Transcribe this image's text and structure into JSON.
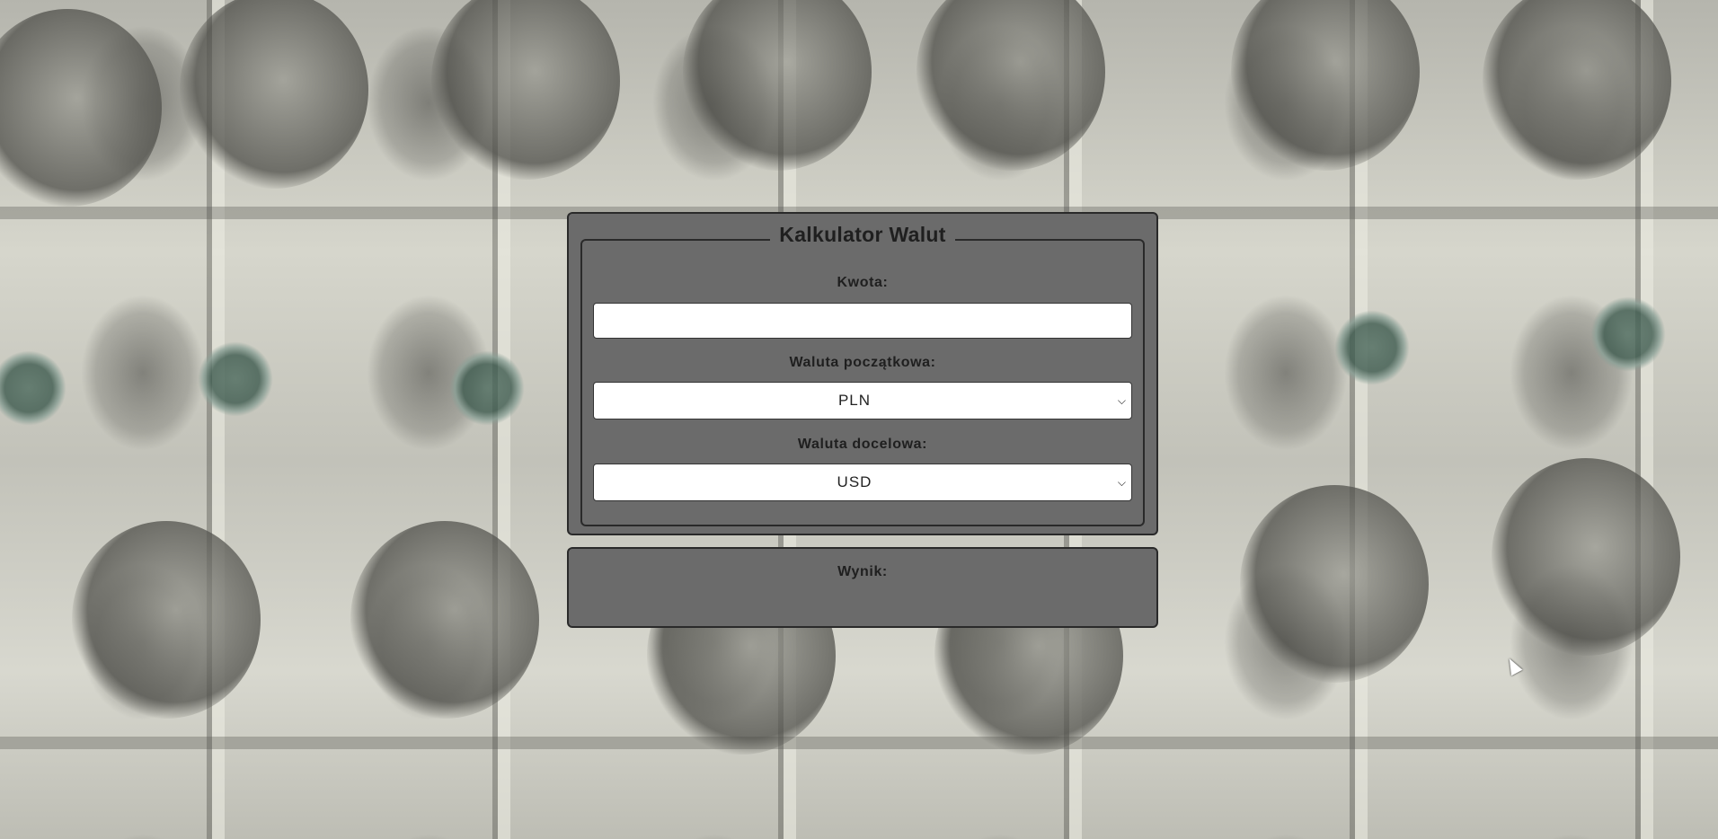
{
  "calculator": {
    "title": "Kalkulator Walut",
    "amount_label": "Kwota:",
    "amount_value": "",
    "from_label": "Waluta początkowa:",
    "from_value": "PLN",
    "to_label": "Waluta docelowa:",
    "to_value": "USD",
    "select_icon": "chevron-down-icon"
  },
  "result": {
    "label": "Wynik:",
    "value": ""
  },
  "background": {
    "description_icon": "banknote-wallpaper"
  },
  "colors": {
    "panel": "#6b6b6b",
    "border": "#2a2a2a",
    "text": "#1f1f1f"
  }
}
